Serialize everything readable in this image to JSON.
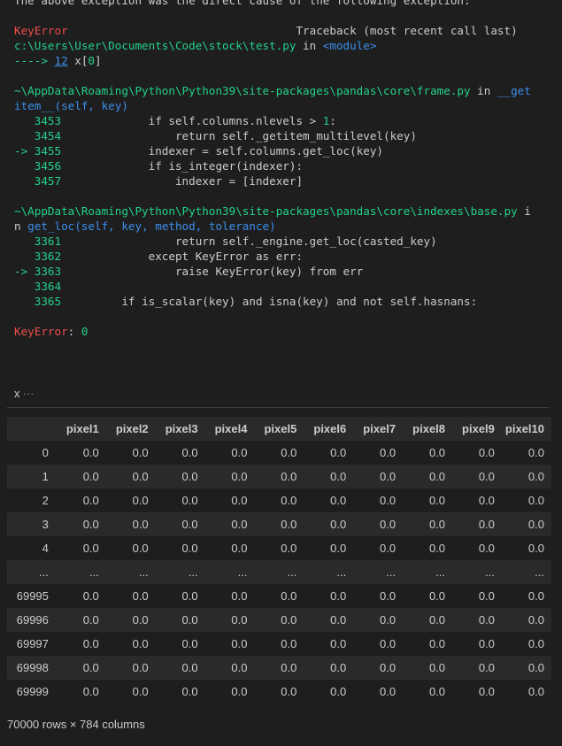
{
  "traceback": {
    "lines": [
      [
        {
          "t": "The above exception was the direct cause of the following exception:",
          "c": "text"
        }
      ],
      [],
      [
        {
          "t": "KeyError",
          "c": "red"
        },
        {
          "t": "                                  Traceback (most recent call last)",
          "c": "text"
        }
      ],
      [
        {
          "t": "c:\\Users\\User\\Documents\\Code\\stock\\test.py",
          "c": "green"
        },
        {
          "t": " in ",
          "c": "text"
        },
        {
          "t": "<module>",
          "c": "blue"
        }
      ],
      [
        {
          "t": "----> ",
          "c": "green"
        },
        {
          "t": "12",
          "c": "link"
        },
        {
          "t": " x[",
          "c": "text"
        },
        {
          "t": "0",
          "c": "green"
        },
        {
          "t": "]",
          "c": "text"
        }
      ],
      [],
      [
        {
          "t": "~\\AppData\\Roaming\\Python\\Python39\\site-packages\\pandas\\core\\frame.py",
          "c": "green"
        },
        {
          "t": " in ",
          "c": "text"
        },
        {
          "t": "__get",
          "c": "blue"
        }
      ],
      [
        {
          "t": "item__(self, key)",
          "c": "blue"
        }
      ],
      [
        {
          "t": "   3453",
          "c": "green"
        },
        {
          "t": "             if self.columns.nlevels ",
          "c": "text"
        },
        {
          "t": ">",
          "c": "text"
        },
        {
          "t": " 1",
          "c": "green"
        },
        {
          "t": ":",
          "c": "text"
        }
      ],
      [
        {
          "t": "   3454",
          "c": "green"
        },
        {
          "t": "                 return self._getitem_multilevel(key)",
          "c": "text"
        }
      ],
      [
        {
          "t": "-> 3455",
          "c": "green"
        },
        {
          "t": "             indexer = self.columns.get_loc(key)",
          "c": "text"
        }
      ],
      [
        {
          "t": "   3456",
          "c": "green"
        },
        {
          "t": "             if is_integer(indexer):",
          "c": "text"
        }
      ],
      [
        {
          "t": "   3457",
          "c": "green"
        },
        {
          "t": "                 indexer = [indexer]",
          "c": "text"
        }
      ],
      [],
      [
        {
          "t": "~\\AppData\\Roaming\\Python\\Python39\\site-packages\\pandas\\core\\indexes\\base.py",
          "c": "green"
        },
        {
          "t": " i",
          "c": "text"
        }
      ],
      [
        {
          "t": "n ",
          "c": "text"
        },
        {
          "t": "get_loc(self, key, method, tolerance)",
          "c": "blue"
        }
      ],
      [
        {
          "t": "   3361",
          "c": "green"
        },
        {
          "t": "                 return self._engine.get_loc(casted_key)",
          "c": "text"
        }
      ],
      [
        {
          "t": "   3362",
          "c": "green"
        },
        {
          "t": "             except KeyError as err:",
          "c": "text"
        }
      ],
      [
        {
          "t": "-> 3363",
          "c": "green"
        },
        {
          "t": "                 raise KeyError(key) from err",
          "c": "text"
        }
      ],
      [
        {
          "t": "   3364",
          "c": "green"
        }
      ],
      [
        {
          "t": "   3365",
          "c": "green"
        },
        {
          "t": "         if is_scalar(key) and isna(key) and not self.hasnans:",
          "c": "text"
        }
      ],
      [],
      [
        {
          "t": "KeyError",
          "c": "red"
        },
        {
          "t": ": ",
          "c": "text"
        },
        {
          "t": "0",
          "c": "green"
        }
      ]
    ]
  },
  "output": {
    "variable_name": "x",
    "ellipsis": "···"
  },
  "dataframe": {
    "columns": [
      "pixel1",
      "pixel2",
      "pixel3",
      "pixel4",
      "pixel5",
      "pixel6",
      "pixel7",
      "pixel8",
      "pixel9",
      "pixel10"
    ],
    "rows": [
      {
        "index": "0",
        "values": [
          "0.0",
          "0.0",
          "0.0",
          "0.0",
          "0.0",
          "0.0",
          "0.0",
          "0.0",
          "0.0",
          "0.0"
        ]
      },
      {
        "index": "1",
        "values": [
          "0.0",
          "0.0",
          "0.0",
          "0.0",
          "0.0",
          "0.0",
          "0.0",
          "0.0",
          "0.0",
          "0.0"
        ]
      },
      {
        "index": "2",
        "values": [
          "0.0",
          "0.0",
          "0.0",
          "0.0",
          "0.0",
          "0.0",
          "0.0",
          "0.0",
          "0.0",
          "0.0"
        ]
      },
      {
        "index": "3",
        "values": [
          "0.0",
          "0.0",
          "0.0",
          "0.0",
          "0.0",
          "0.0",
          "0.0",
          "0.0",
          "0.0",
          "0.0"
        ]
      },
      {
        "index": "4",
        "values": [
          "0.0",
          "0.0",
          "0.0",
          "0.0",
          "0.0",
          "0.0",
          "0.0",
          "0.0",
          "0.0",
          "0.0"
        ]
      },
      {
        "index": "...",
        "values": [
          "...",
          "...",
          "...",
          "...",
          "...",
          "...",
          "...",
          "...",
          "...",
          "..."
        ]
      },
      {
        "index": "69995",
        "values": [
          "0.0",
          "0.0",
          "0.0",
          "0.0",
          "0.0",
          "0.0",
          "0.0",
          "0.0",
          "0.0",
          "0.0"
        ]
      },
      {
        "index": "69996",
        "values": [
          "0.0",
          "0.0",
          "0.0",
          "0.0",
          "0.0",
          "0.0",
          "0.0",
          "0.0",
          "0.0",
          "0.0"
        ]
      },
      {
        "index": "69997",
        "values": [
          "0.0",
          "0.0",
          "0.0",
          "0.0",
          "0.0",
          "0.0",
          "0.0",
          "0.0",
          "0.0",
          "0.0"
        ]
      },
      {
        "index": "69998",
        "values": [
          "0.0",
          "0.0",
          "0.0",
          "0.0",
          "0.0",
          "0.0",
          "0.0",
          "0.0",
          "0.0",
          "0.0"
        ]
      },
      {
        "index": "69999",
        "values": [
          "0.0",
          "0.0",
          "0.0",
          "0.0",
          "0.0",
          "0.0",
          "0.0",
          "0.0",
          "0.0",
          "0.0"
        ]
      }
    ],
    "footer": "70000 rows × 784 columns"
  },
  "colors": {
    "background": "#1e1e1e",
    "text": "#cccccc",
    "error_red": "#f14c4c",
    "path_green": "#23d18b",
    "name_blue": "#3b8eea",
    "row_stripe": "#2a2a2a"
  }
}
